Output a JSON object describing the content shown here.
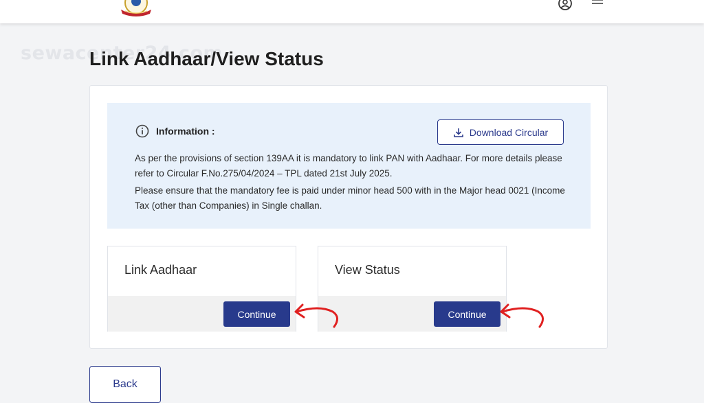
{
  "watermark": "sewacenter24.com",
  "page": {
    "title": "Link Aadhaar/View Status"
  },
  "info": {
    "heading": "Information :",
    "download_label": "Download Circular",
    "paragraphs": [
      "As per the provisions of section 139AA it is mandatory to link PAN with Aadhaar. For more details please refer to Circular F.No.275/04/2024 – TPL dated 21st July 2025.",
      "Please ensure that the mandatory fee is paid under minor head 500 with in the Major head 0021 (Income Tax (other than Companies) in Single challan."
    ]
  },
  "tiles": [
    {
      "title": "Link Aadhaar",
      "button": "Continue"
    },
    {
      "title": "View Status",
      "button": "Continue"
    }
  ],
  "back_label": "Back",
  "icons": {
    "info": "info-circle-icon",
    "download": "download-icon",
    "profile": "user-circle-icon",
    "menu": "hamburger-menu-icon",
    "logo": "emblem-logo"
  },
  "colors": {
    "primary": "#283a8c",
    "info_bg": "#e8f1fb",
    "annotation_arrow": "#e02020"
  }
}
